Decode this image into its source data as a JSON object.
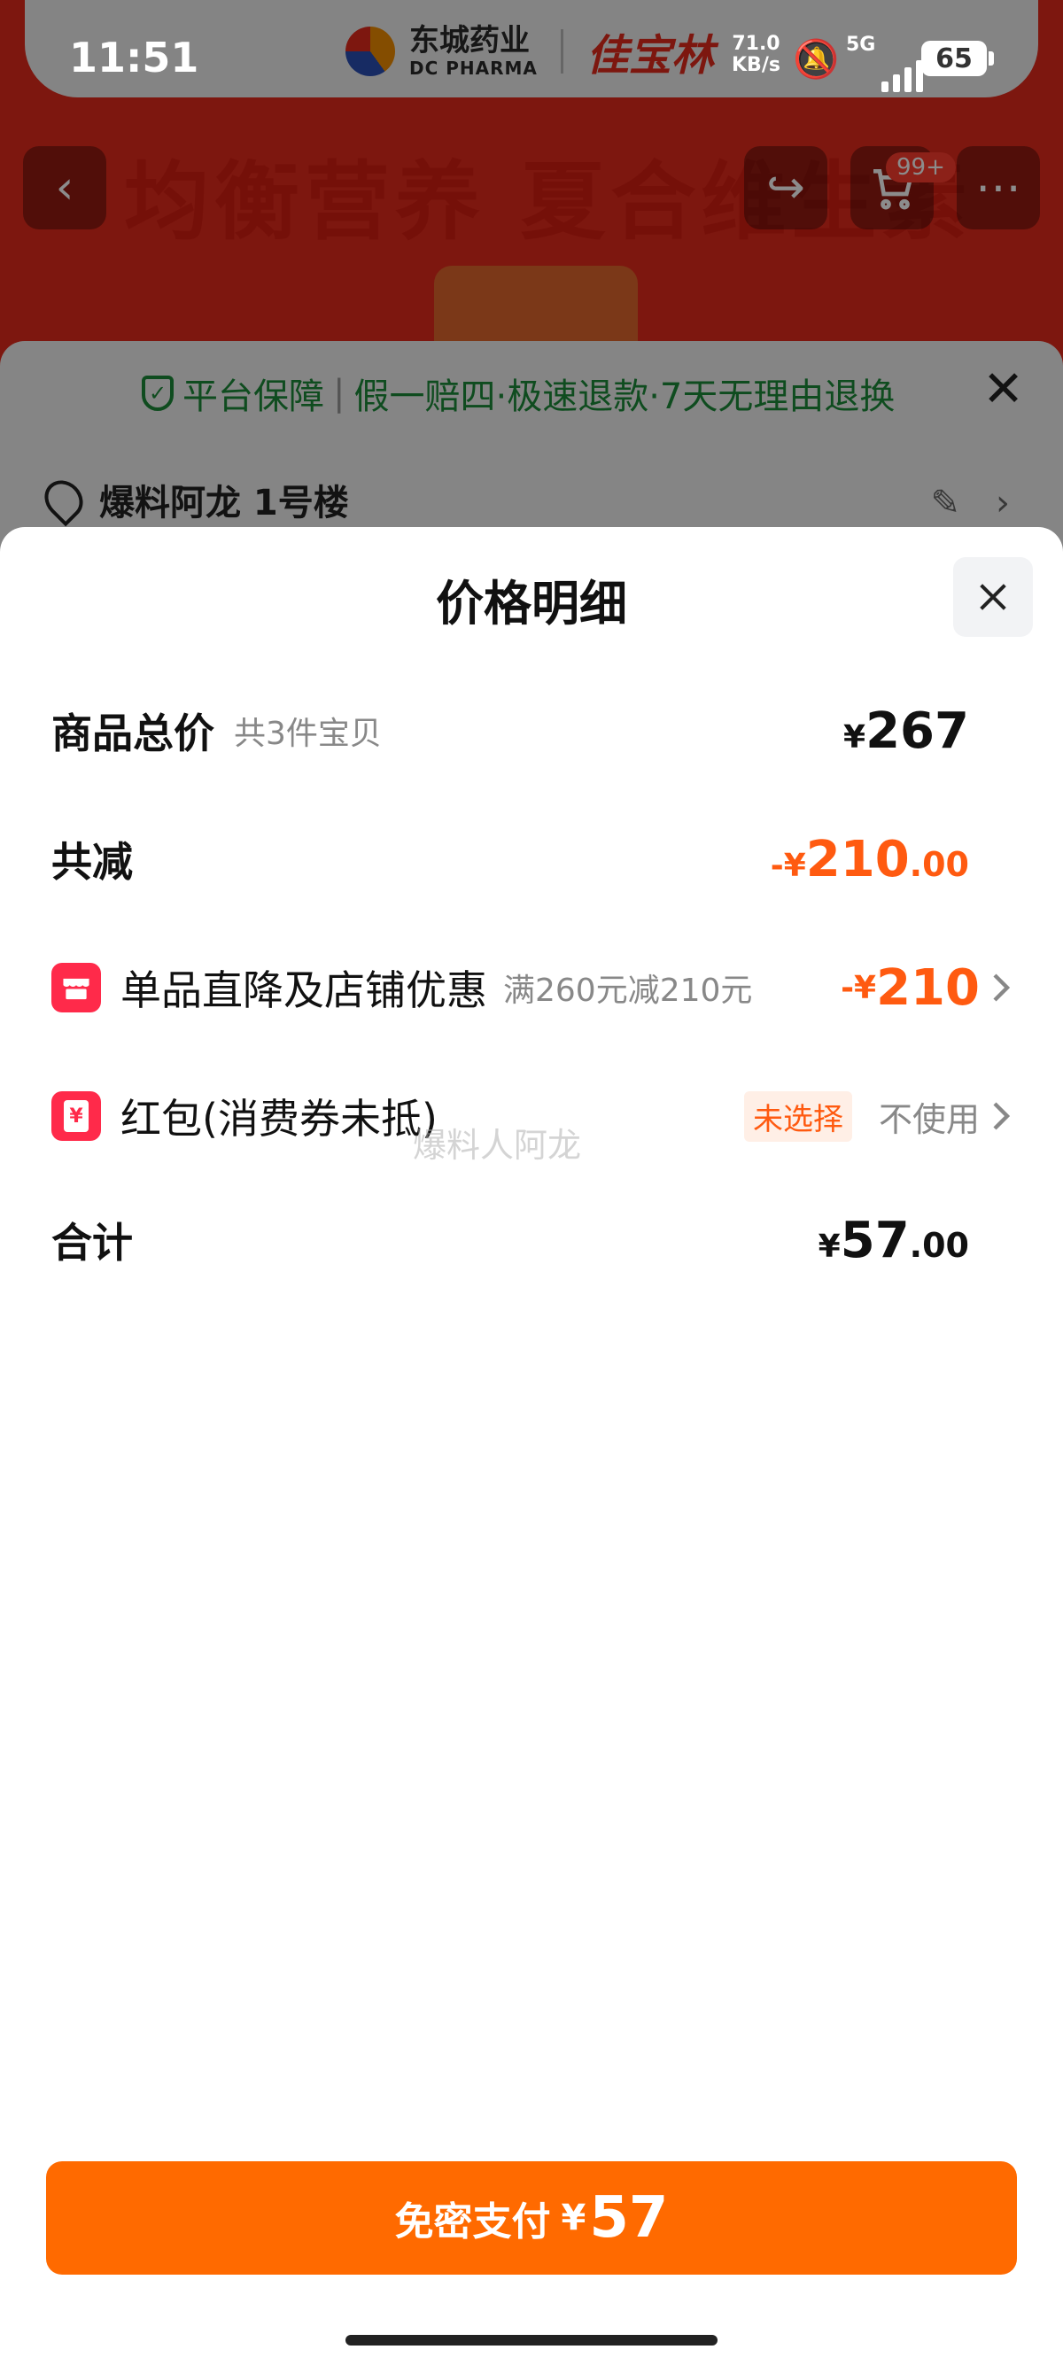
{
  "status_bar": {
    "time": "11:51",
    "net_speed_value": "71.0",
    "net_speed_unit": "KB/s",
    "network": "5G",
    "battery": "65"
  },
  "background": {
    "brand_cn": "东城药业",
    "brand_en": "DC PHARMA",
    "brand_2": "佳宝林",
    "headline": "均衡营养 夏合维生素",
    "cart_badge": "99+",
    "guarantee": {
      "platform": "平台保障",
      "separator": "|",
      "details": "假一赔四·极速退款·7天无理由退换"
    },
    "address": "爆料阿龙 1号楼"
  },
  "modal": {
    "title": "价格明细",
    "rows": {
      "total": {
        "label": "商品总价",
        "sub": "共3件宝贝",
        "currency": "¥",
        "amount": "267"
      },
      "reduction": {
        "label": "共减",
        "prefix": "-¥",
        "amount": "210",
        "decimal": ".00"
      },
      "store_discount": {
        "label": "单品直降及店铺优惠",
        "sub": "满260元减210元",
        "prefix": "-¥",
        "amount": "210"
      },
      "red_packet": {
        "label": "红包(消费券未抵)",
        "tag": "未选择",
        "status": "不使用"
      },
      "sum": {
        "label": "合计",
        "currency": "¥",
        "amount": "57",
        "decimal": ".00"
      }
    },
    "watermark": "爆料人阿龙",
    "pay_button": {
      "label": "免密支付",
      "currency": "¥",
      "amount": "57"
    }
  },
  "colors": {
    "accent": "#ff6a00",
    "discount": "#ff5a10",
    "banner": "#e32a1c",
    "guarantee": "#1c8a3a"
  },
  "icons": [
    "back-icon",
    "share-icon",
    "cart-icon",
    "more-icon",
    "shield-icon",
    "close-icon",
    "location-pin-icon",
    "edit-icon",
    "chevron-right-icon",
    "store-icon",
    "red-packet-icon"
  ]
}
